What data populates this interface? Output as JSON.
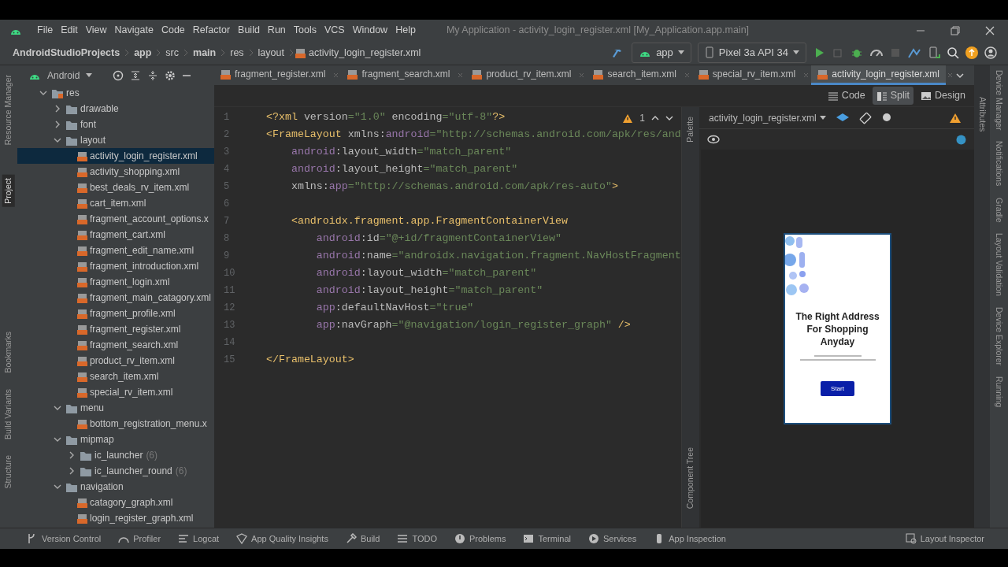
{
  "menu_bar": {
    "items": [
      "File",
      "Edit",
      "View",
      "Navigate",
      "Code",
      "Refactor",
      "Build",
      "Run",
      "Tools",
      "VCS",
      "Window",
      "Help"
    ],
    "window_title": "My Application - activity_login_register.xml [My_Application.app.main]"
  },
  "breadcrumb": [
    {
      "label": "AndroidStudioProjects",
      "bold": true
    },
    {
      "label": "app",
      "bold": true
    },
    {
      "label": "src",
      "bold": false
    },
    {
      "label": "main",
      "bold": true
    },
    {
      "label": "res",
      "bold": false
    },
    {
      "label": "layout",
      "bold": false
    },
    {
      "label": "activity_login_register.xml",
      "bold": false,
      "kind": "file"
    }
  ],
  "toolbar": {
    "run_config": "app",
    "device": "Pixel 3a API 34"
  },
  "left_stripe": [
    {
      "label": "Resource Manager",
      "selected": false
    },
    {
      "label": "Project",
      "selected": true
    },
    {
      "label": "Bookmarks",
      "selected": false
    },
    {
      "label": "Build Variants",
      "selected": false
    },
    {
      "label": "Structure",
      "selected": false
    }
  ],
  "project_panel": {
    "view": "Android",
    "tree": [
      {
        "label": "res",
        "kind": "res",
        "expanded": true,
        "children": [
          {
            "label": "drawable",
            "kind": "folder",
            "expanded": false
          },
          {
            "label": "font",
            "kind": "folder",
            "expanded": false
          },
          {
            "label": "layout",
            "kind": "folder",
            "expanded": true,
            "children": [
              {
                "label": "activity_login_register.xml",
                "kind": "file",
                "selected": true
              },
              {
                "label": "activity_shopping.xml",
                "kind": "file",
                "selected": false
              },
              {
                "label": "best_deals_rv_item.xml",
                "kind": "file",
                "selected": false
              },
              {
                "label": "cart_item.xml",
                "kind": "file",
                "selected": false
              },
              {
                "label": "fragment_account_options.x",
                "kind": "file",
                "selected": false
              },
              {
                "label": "fragment_cart.xml",
                "kind": "file",
                "selected": false
              },
              {
                "label": "fragment_edit_name.xml",
                "kind": "file",
                "selected": false
              },
              {
                "label": "fragment_introduction.xml",
                "kind": "file",
                "selected": false
              },
              {
                "label": "fragment_login.xml",
                "kind": "file",
                "selected": false
              },
              {
                "label": "fragment_main_catagory.xml",
                "kind": "file",
                "selected": false
              },
              {
                "label": "fragment_profile.xml",
                "kind": "file",
                "selected": false
              },
              {
                "label": "fragment_register.xml",
                "kind": "file",
                "selected": false
              },
              {
                "label": "fragment_search.xml",
                "kind": "file",
                "selected": false
              },
              {
                "label": "product_rv_item.xml",
                "kind": "file",
                "selected": false
              },
              {
                "label": "search_item.xml",
                "kind": "file",
                "selected": false
              },
              {
                "label": "special_rv_item.xml",
                "kind": "file",
                "selected": false
              }
            ]
          },
          {
            "label": "menu",
            "kind": "folder",
            "expanded": true,
            "children": [
              {
                "label": "bottom_registration_menu.x",
                "kind": "file",
                "selected": false
              }
            ]
          },
          {
            "label": "mipmap",
            "kind": "folder",
            "expanded": true,
            "children": [
              {
                "label": "ic_launcher",
                "kind": "folder",
                "expanded": false,
                "count": "(6)"
              },
              {
                "label": "ic_launcher_round",
                "kind": "folder",
                "expanded": false,
                "count": "(6)"
              }
            ]
          },
          {
            "label": "navigation",
            "kind": "folder",
            "expanded": true,
            "children": [
              {
                "label": "catagory_graph.xml",
                "kind": "file",
                "selected": false
              },
              {
                "label": "login_register_graph.xml",
                "kind": "file",
                "selected": false
              }
            ]
          }
        ]
      }
    ]
  },
  "editor_tabs": [
    {
      "label": "fragment_register.xml",
      "selected": false
    },
    {
      "label": "fragment_search.xml",
      "selected": false
    },
    {
      "label": "product_rv_item.xml",
      "selected": false
    },
    {
      "label": "search_item.xml",
      "selected": false
    },
    {
      "label": "special_rv_item.xml",
      "selected": false
    },
    {
      "label": "activity_login_register.xml",
      "selected": true
    }
  ],
  "view_modes": [
    {
      "label": "Code",
      "selected": false
    },
    {
      "label": "Split",
      "selected": true
    },
    {
      "label": "Design",
      "selected": false
    }
  ],
  "warnings": "1",
  "code_lines": [
    {
      "number": "1",
      "segments": [
        {
          "text": "<?xml ",
          "kind": "tag"
        },
        {
          "text": "version",
          "kind": "attr"
        },
        {
          "text": "=\"1.0\" ",
          "kind": "value"
        },
        {
          "text": "encoding",
          "kind": "attr"
        },
        {
          "text": "=\"utf-8\"",
          "kind": "value"
        },
        {
          "text": "?>",
          "kind": "tag"
        }
      ]
    },
    {
      "number": "2",
      "segments": [
        {
          "text": "<FrameLayout ",
          "kind": "tag"
        },
        {
          "text": "xmlns:",
          "kind": "attr"
        },
        {
          "text": "android",
          "kind": "ns"
        },
        {
          "text": "=\"http://schemas.android.com/apk/res/and",
          "kind": "value"
        }
      ]
    },
    {
      "number": "3",
      "segments": [
        {
          "text": "    android",
          "kind": "ns"
        },
        {
          "text": ":layout_width",
          "kind": "attr"
        },
        {
          "text": "=\"match_parent\"",
          "kind": "value"
        }
      ]
    },
    {
      "number": "4",
      "segments": [
        {
          "text": "    android",
          "kind": "ns"
        },
        {
          "text": ":layout_height",
          "kind": "attr"
        },
        {
          "text": "=\"match_parent\"",
          "kind": "value"
        }
      ]
    },
    {
      "number": "5",
      "segments": [
        {
          "text": "    xmlns:",
          "kind": "attr"
        },
        {
          "text": "app",
          "kind": "ns"
        },
        {
          "text": "=\"http://schemas.android.com/apk/res-auto\"",
          "kind": "value"
        },
        {
          "text": ">",
          "kind": "tag"
        }
      ]
    },
    {
      "number": "6"
    },
    {
      "number": "7",
      "segments": [
        {
          "text": "    <androidx.fragment.app.FragmentContainerView",
          "kind": "tag"
        }
      ]
    },
    {
      "number": "8",
      "segments": [
        {
          "text": "        android",
          "kind": "ns"
        },
        {
          "text": ":id",
          "kind": "attr"
        },
        {
          "text": "=\"@+id/fragmentContainerView\"",
          "kind": "value"
        }
      ]
    },
    {
      "number": "9",
      "segments": [
        {
          "text": "        android",
          "kind": "ns"
        },
        {
          "text": ":name",
          "kind": "attr"
        },
        {
          "text": "=\"androidx.navigation.fragment.NavHostFragment",
          "kind": "value"
        }
      ]
    },
    {
      "number": "10",
      "segments": [
        {
          "text": "        android",
          "kind": "ns"
        },
        {
          "text": ":layout_width",
          "kind": "attr"
        },
        {
          "text": "=\"match_parent\"",
          "kind": "value"
        }
      ]
    },
    {
      "number": "11",
      "segments": [
        {
          "text": "        android",
          "kind": "ns"
        },
        {
          "text": ":layout_height",
          "kind": "attr"
        },
        {
          "text": "=\"match_parent\"",
          "kind": "value"
        }
      ]
    },
    {
      "number": "12",
      "segments": [
        {
          "text": "        app",
          "kind": "ns"
        },
        {
          "text": ":defaultNavHost",
          "kind": "attr"
        },
        {
          "text": "=\"true\"",
          "kind": "value"
        }
      ]
    },
    {
      "number": "13",
      "segments": [
        {
          "text": "        app",
          "kind": "ns"
        },
        {
          "text": ":navGraph",
          "kind": "attr"
        },
        {
          "text": "=\"@navigation/login_register_graph\"",
          "kind": "value"
        },
        {
          "text": " />",
          "kind": "tag"
        }
      ]
    },
    {
      "number": "14"
    },
    {
      "number": "15",
      "segments": [
        {
          "text": "</FrameLayout>",
          "kind": "tag"
        }
      ]
    }
  ],
  "preview": {
    "file": "activity_login_register.xml",
    "palette_label": "Palette",
    "component_tree_label": "Component Tree",
    "heading": "The Right Address For Shopping Anyday",
    "button": "Start"
  },
  "attributes_label": "Attributes",
  "right_stripe": [
    "Device Manager",
    "Notifications",
    "Gradle",
    "Layout Validation",
    "Device Explorer",
    "Running"
  ],
  "bottom_tools": [
    "Version Control",
    "Profiler",
    "Logcat",
    "App Quality Insights",
    "Build",
    "TODO",
    "Problems",
    "Terminal",
    "Services",
    "App Inspection"
  ],
  "layout_inspector": "Layout Inspector"
}
